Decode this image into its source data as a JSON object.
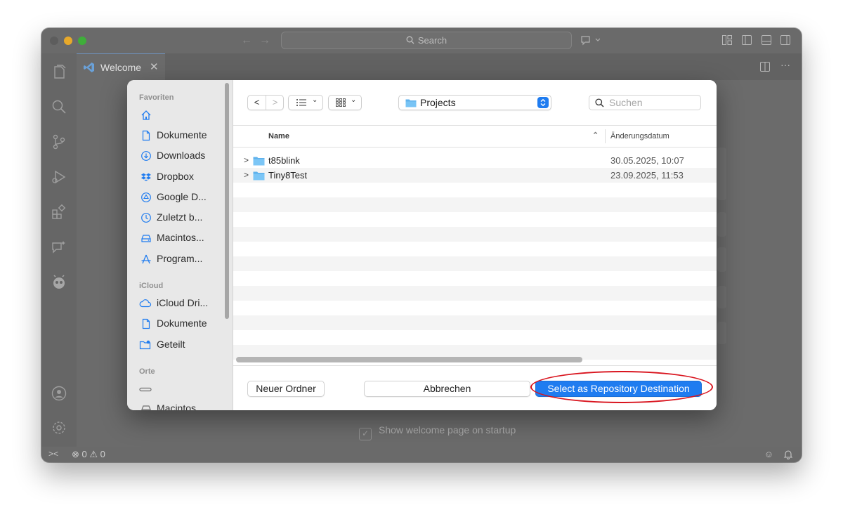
{
  "window": {
    "search_label": "Search",
    "tab_label": "Welcome",
    "welcome_checkbox_label": "Show welcome page on startup",
    "status": {
      "errors": "0",
      "warnings": "0"
    }
  },
  "dialog": {
    "location": "Projects",
    "search_placeholder": "Suchen",
    "sidebar": {
      "favorites_heading": "Favoriten",
      "favorites": [
        {
          "label": "",
          "icon": "home-icon"
        },
        {
          "label": "Dokumente",
          "icon": "document-icon"
        },
        {
          "label": "Downloads",
          "icon": "download-icon"
        },
        {
          "label": "Dropbox",
          "icon": "dropbox-icon"
        },
        {
          "label": "Google D...",
          "icon": "google-drive-icon"
        },
        {
          "label": "Zuletzt b...",
          "icon": "clock-icon"
        },
        {
          "label": "Macintos...",
          "icon": "disk-icon"
        },
        {
          "label": "Program...",
          "icon": "applications-icon"
        }
      ],
      "icloud_heading": "iCloud",
      "icloud": [
        {
          "label": "iCloud Dri...",
          "icon": "cloud-icon"
        },
        {
          "label": "Dokumente",
          "icon": "document-icon"
        },
        {
          "label": "Geteilt",
          "icon": "shared-folder-icon"
        }
      ],
      "places_heading": "Orte",
      "places": [
        {
          "label": "",
          "icon": "drive-icon"
        },
        {
          "label": "Macintos...",
          "icon": "disk-icon"
        }
      ]
    },
    "columns": {
      "name": "Name",
      "modified": "Änderungsdatum"
    },
    "files": [
      {
        "name": "t85blink",
        "modified": "30.05.2025, 10:07"
      },
      {
        "name": "Tiny8Test",
        "modified": "23.09.2025, 11:53"
      }
    ],
    "buttons": {
      "new_folder": "Neuer Ordner",
      "cancel": "Abbrechen",
      "select": "Select as Repository Destination"
    },
    "accent_color": "#1f7cf0",
    "annotation_color": "#d9141e"
  }
}
